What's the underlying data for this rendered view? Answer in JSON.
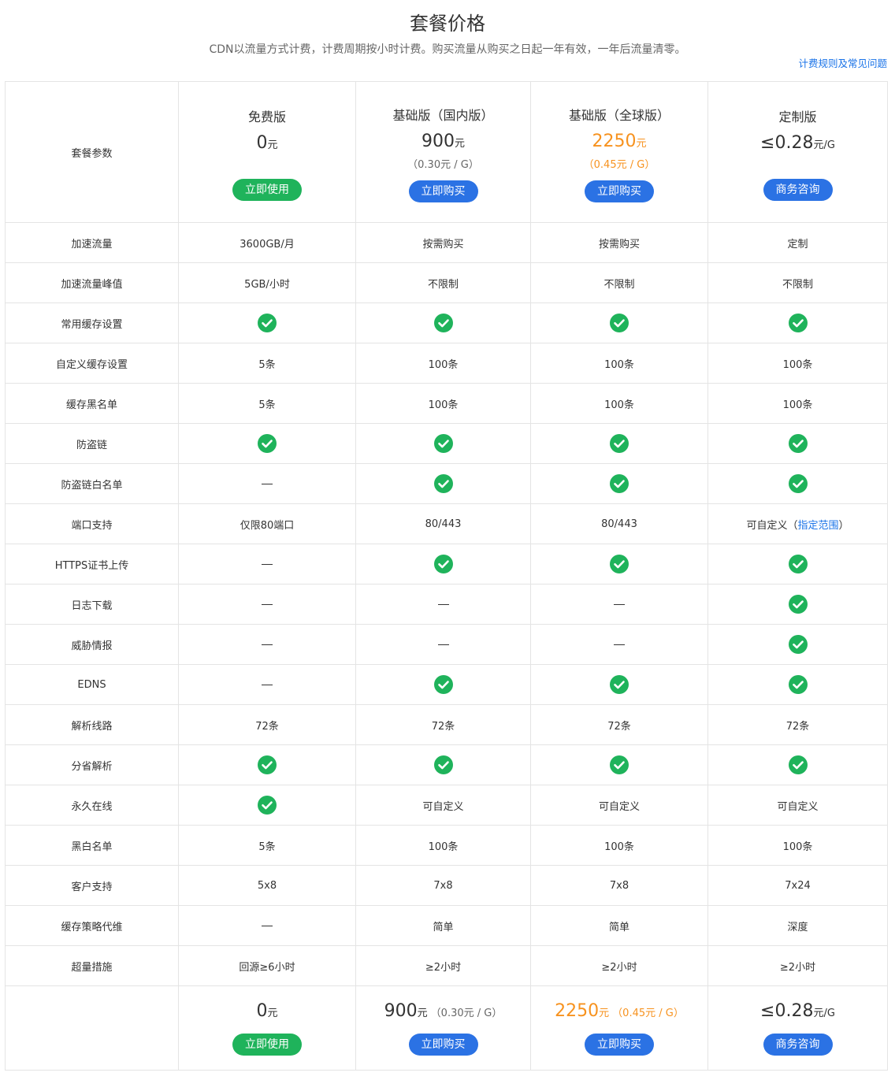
{
  "page": {
    "title": "套餐价格",
    "subtitle": "CDN以流量方式计费，计费周期按小时计费。购买流量从购买之日起一年有效，一年后流量清零。",
    "faq_link": "计费规则及常见问题"
  },
  "colors": {
    "accent_orange": "#f7921e",
    "button_green": "#1fb35b",
    "button_blue": "#2b72e4",
    "check_green": "#1fb35b",
    "link_blue": "#1a73e8"
  },
  "header_row": {
    "label": "套餐参数",
    "plans": [
      {
        "name": "免费版",
        "price": "0",
        "unit": "元",
        "per_gb": "",
        "button": "立即使用",
        "button_color": "green",
        "highlight": false
      },
      {
        "name": "基础版（国内版）",
        "price": "900",
        "unit": "元",
        "per_gb": "（0.30元 / G）",
        "button": "立即购买",
        "button_color": "blue",
        "highlight": false
      },
      {
        "name": "基础版（全球版）",
        "price": "2250",
        "unit": "元",
        "per_gb": "（0.45元 / G）",
        "button": "立即购买",
        "button_color": "blue",
        "highlight": true
      },
      {
        "name": "定制版",
        "price": "≤0.28",
        "unit": "元/G",
        "per_gb": "",
        "button": "商务咨询",
        "button_color": "blue",
        "highlight": false
      }
    ]
  },
  "features": [
    {
      "label": "加速流量",
      "cells": [
        {
          "type": "text",
          "value": "3600GB/月"
        },
        {
          "type": "text",
          "value": "按需购买"
        },
        {
          "type": "text",
          "value": "按需购买"
        },
        {
          "type": "text",
          "value": "定制"
        }
      ]
    },
    {
      "label": "加速流量峰值",
      "cells": [
        {
          "type": "text",
          "value": "5GB/小时"
        },
        {
          "type": "text",
          "value": "不限制"
        },
        {
          "type": "text",
          "value": "不限制"
        },
        {
          "type": "text",
          "value": "不限制"
        }
      ]
    },
    {
      "label": "常用缓存设置",
      "cells": [
        {
          "type": "check"
        },
        {
          "type": "check"
        },
        {
          "type": "check"
        },
        {
          "type": "check"
        }
      ]
    },
    {
      "label": "自定义缓存设置",
      "cells": [
        {
          "type": "text",
          "value": "5条"
        },
        {
          "type": "text",
          "value": "100条"
        },
        {
          "type": "text",
          "value": "100条"
        },
        {
          "type": "text",
          "value": "100条"
        }
      ]
    },
    {
      "label": "缓存黑名单",
      "cells": [
        {
          "type": "text",
          "value": "5条"
        },
        {
          "type": "text",
          "value": "100条"
        },
        {
          "type": "text",
          "value": "100条"
        },
        {
          "type": "text",
          "value": "100条"
        }
      ]
    },
    {
      "label": "防盗链",
      "cells": [
        {
          "type": "check"
        },
        {
          "type": "check"
        },
        {
          "type": "check"
        },
        {
          "type": "check"
        }
      ]
    },
    {
      "label": "防盗链白名单",
      "cells": [
        {
          "type": "dash"
        },
        {
          "type": "check"
        },
        {
          "type": "check"
        },
        {
          "type": "check"
        }
      ]
    },
    {
      "label": "端口支持",
      "cells": [
        {
          "type": "text",
          "value": "仅限80端口"
        },
        {
          "type": "text",
          "value": "80/443"
        },
        {
          "type": "text",
          "value": "80/443"
        },
        {
          "type": "link",
          "prefix": "可自定义（",
          "link": "指定范围",
          "suffix": "）"
        }
      ]
    },
    {
      "label": "HTTPS证书上传",
      "cells": [
        {
          "type": "dash"
        },
        {
          "type": "check"
        },
        {
          "type": "check"
        },
        {
          "type": "check"
        }
      ]
    },
    {
      "label": "日志下载",
      "cells": [
        {
          "type": "dash"
        },
        {
          "type": "dash"
        },
        {
          "type": "dash"
        },
        {
          "type": "check"
        }
      ]
    },
    {
      "label": "威胁情报",
      "cells": [
        {
          "type": "dash"
        },
        {
          "type": "dash"
        },
        {
          "type": "dash"
        },
        {
          "type": "check"
        }
      ]
    },
    {
      "label": "EDNS",
      "cells": [
        {
          "type": "dash"
        },
        {
          "type": "check"
        },
        {
          "type": "check"
        },
        {
          "type": "check"
        }
      ]
    },
    {
      "label": "解析线路",
      "cells": [
        {
          "type": "text",
          "value": "72条"
        },
        {
          "type": "text",
          "value": "72条"
        },
        {
          "type": "text",
          "value": "72条"
        },
        {
          "type": "text",
          "value": "72条"
        }
      ]
    },
    {
      "label": "分省解析",
      "cells": [
        {
          "type": "check"
        },
        {
          "type": "check"
        },
        {
          "type": "check"
        },
        {
          "type": "check"
        }
      ]
    },
    {
      "label": "永久在线",
      "cells": [
        {
          "type": "check"
        },
        {
          "type": "text",
          "value": "可自定义"
        },
        {
          "type": "text",
          "value": "可自定义"
        },
        {
          "type": "text",
          "value": "可自定义"
        }
      ]
    },
    {
      "label": "黑白名单",
      "cells": [
        {
          "type": "text",
          "value": "5条"
        },
        {
          "type": "text",
          "value": "100条"
        },
        {
          "type": "text",
          "value": "100条"
        },
        {
          "type": "text",
          "value": "100条"
        }
      ]
    },
    {
      "label": "客户支持",
      "cells": [
        {
          "type": "text",
          "value": "5x8"
        },
        {
          "type": "text",
          "value": "7x8"
        },
        {
          "type": "text",
          "value": "7x8"
        },
        {
          "type": "text",
          "value": "7x24"
        }
      ]
    },
    {
      "label": "缓存策略代维",
      "cells": [
        {
          "type": "dash"
        },
        {
          "type": "text",
          "value": "简单"
        },
        {
          "type": "text",
          "value": "简单"
        },
        {
          "type": "text",
          "value": "深度"
        }
      ]
    },
    {
      "label": "超量措施",
      "cells": [
        {
          "type": "text",
          "value": "回源≥6小时"
        },
        {
          "type": "text",
          "value": "≥2小时"
        },
        {
          "type": "text",
          "value": "≥2小时"
        },
        {
          "type": "text",
          "value": "≥2小时"
        }
      ]
    }
  ],
  "footer_row": {
    "label": "",
    "plans": [
      {
        "price": "0",
        "unit": "元",
        "per_gb": "",
        "button": "立即使用",
        "button_color": "green",
        "highlight": false
      },
      {
        "price": "900",
        "unit": "元",
        "per_gb": "（0.30元 / G）",
        "button": "立即购买",
        "button_color": "blue",
        "highlight": false
      },
      {
        "price": "2250",
        "unit": "元",
        "per_gb": "（0.45元 / G）",
        "button": "立即购买",
        "button_color": "blue",
        "highlight": true
      },
      {
        "price": "≤0.28",
        "unit": "元/G",
        "per_gb": "",
        "button": "商务咨询",
        "button_color": "blue",
        "highlight": false
      }
    ]
  }
}
